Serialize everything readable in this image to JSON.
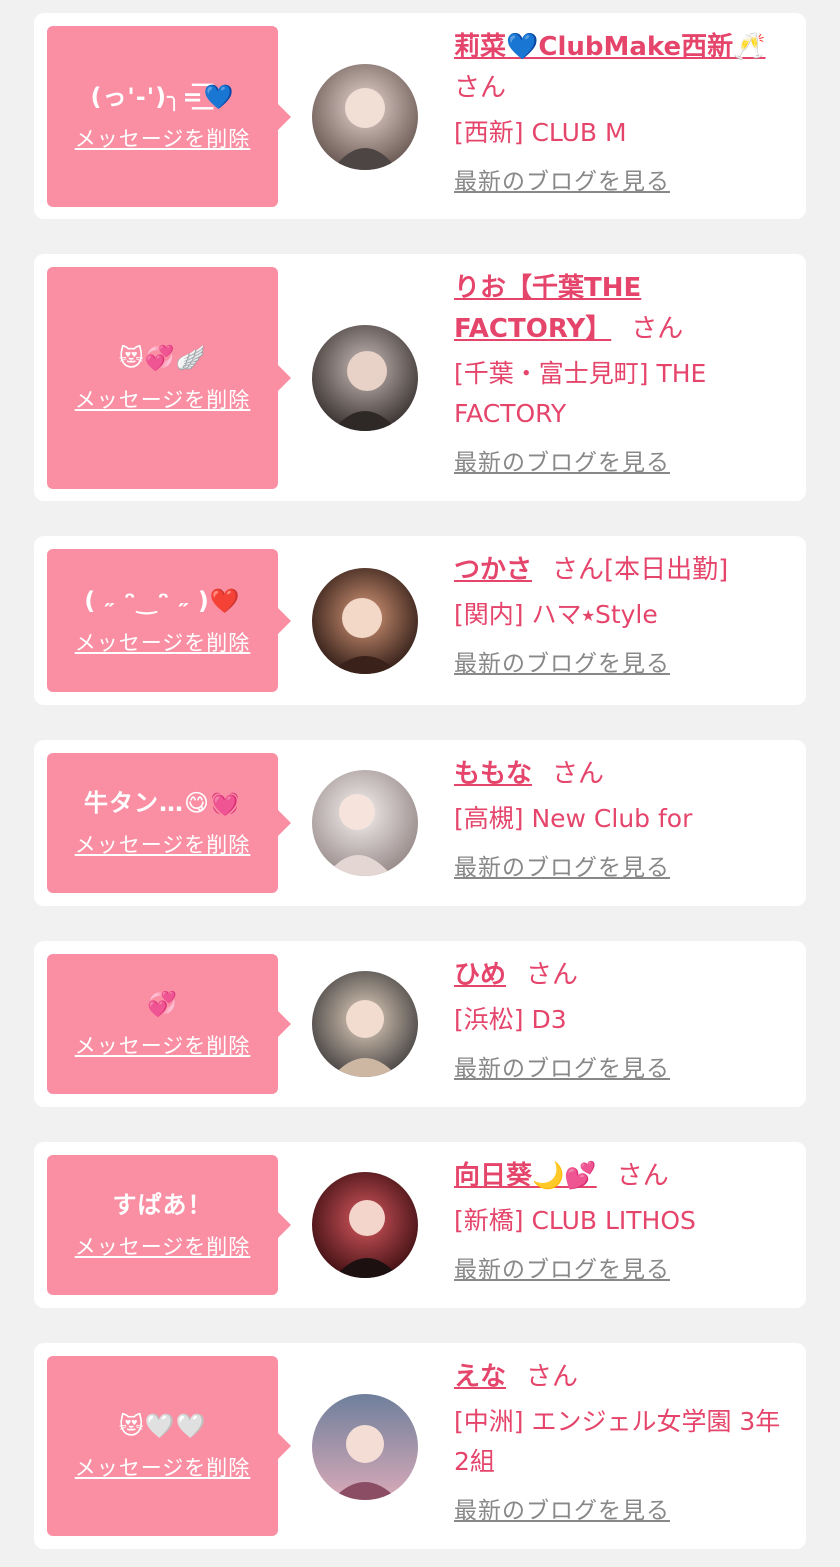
{
  "delete_label": "メッセージを削除",
  "blog_label": "最新のブログを見る",
  "san_label": "さん",
  "messages": [
    {
      "bubble_text": "(っ'-')╮=͟͟͞͞💙",
      "name": "莉菜💙ClubMake西新🥂",
      "san_suffix": "",
      "shop": "[西新] CLUB M",
      "avatar_colors": [
        "#c9b3b5",
        "#6b5a54"
      ]
    },
    {
      "bubble_text": "😻💞🪽",
      "name": "りお【千葉THE FACTORY】",
      "san_suffix": "",
      "shop": "[千葉・富士見町] THE FACTORY",
      "avatar_colors": [
        "#8a7c78",
        "#3b3432"
      ]
    },
    {
      "bubble_text": "( ˶ ᵔ‿ᵔ ˶ )❤️",
      "name": "つかさ",
      "san_suffix": "[本日出勤]",
      "shop": "[関内] ハマ⭑Style",
      "avatar_colors": [
        "#7c4a3a",
        "#2a1813"
      ]
    },
    {
      "bubble_text": "牛タン…😋💓",
      "name": "ももな",
      "san_suffix": "",
      "shop": "[高槻] New Club for",
      "avatar_colors": [
        "#ebe6e4",
        "#9c8f8e"
      ]
    },
    {
      "bubble_text": "💞",
      "name": "ひめ",
      "san_suffix": "",
      "shop": "[浜松] D3",
      "avatar_colors": [
        "#5a5858",
        "#c8b6a4"
      ]
    },
    {
      "bubble_text": "すぱあ！",
      "name": "向日葵🌙💕",
      "san_suffix": "",
      "shop": "[新橋] CLUB LITHOS",
      "avatar_colors": [
        "#9b1b24",
        "#3a0d10"
      ]
    },
    {
      "bubble_text": "😻🤍🤍",
      "name": "えな",
      "san_suffix": "",
      "shop": "[中洲] エンジェル女学園 3年2組",
      "avatar_colors": [
        "#5e6e8a",
        "#c9a8b4"
      ]
    }
  ]
}
